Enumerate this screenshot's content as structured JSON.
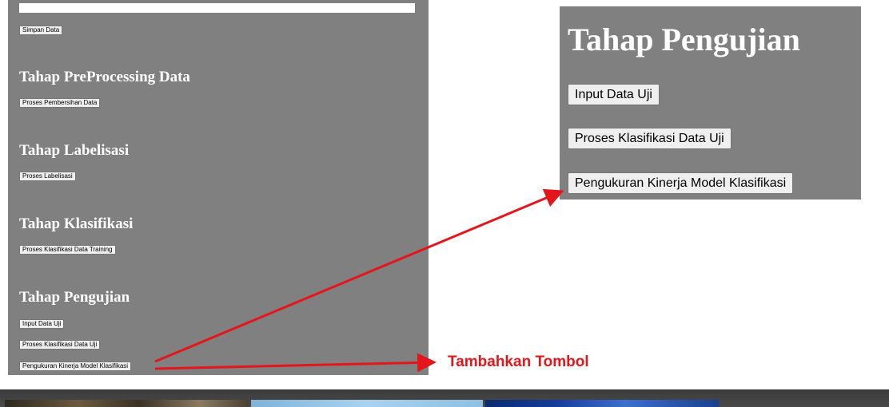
{
  "left_panel": {
    "save_button": "Simpan Data",
    "sections": [
      {
        "heading": "Tahap PreProcessing Data",
        "buttons": [
          "Proses Pembersihan Data"
        ]
      },
      {
        "heading": "Tahap Labelisasi",
        "buttons": [
          "Proses Labelisasi"
        ]
      },
      {
        "heading": "Tahap Klasifikasi",
        "buttons": [
          "Proses Klasifikasi Data Training"
        ]
      },
      {
        "heading": "Tahap Pengujian",
        "buttons": [
          "Input Data Uji",
          "Proses Klasifikasi Data Uji",
          "Pengukuran Kinerja Model Klasifikasi"
        ]
      }
    ]
  },
  "right_panel": {
    "heading": "Tahap Pengujian",
    "buttons": [
      "Input Data Uji",
      "Proses Klasifikasi Data Uji",
      "Pengukuran Kinerja Model Klasifikasi"
    ]
  },
  "annotation": {
    "label": "Tambahkan Tombol",
    "color": "#e5161b"
  },
  "colors": {
    "panel_bg": "#808080",
    "heading_text": "#ffffff",
    "button_bg": "#efefef"
  }
}
